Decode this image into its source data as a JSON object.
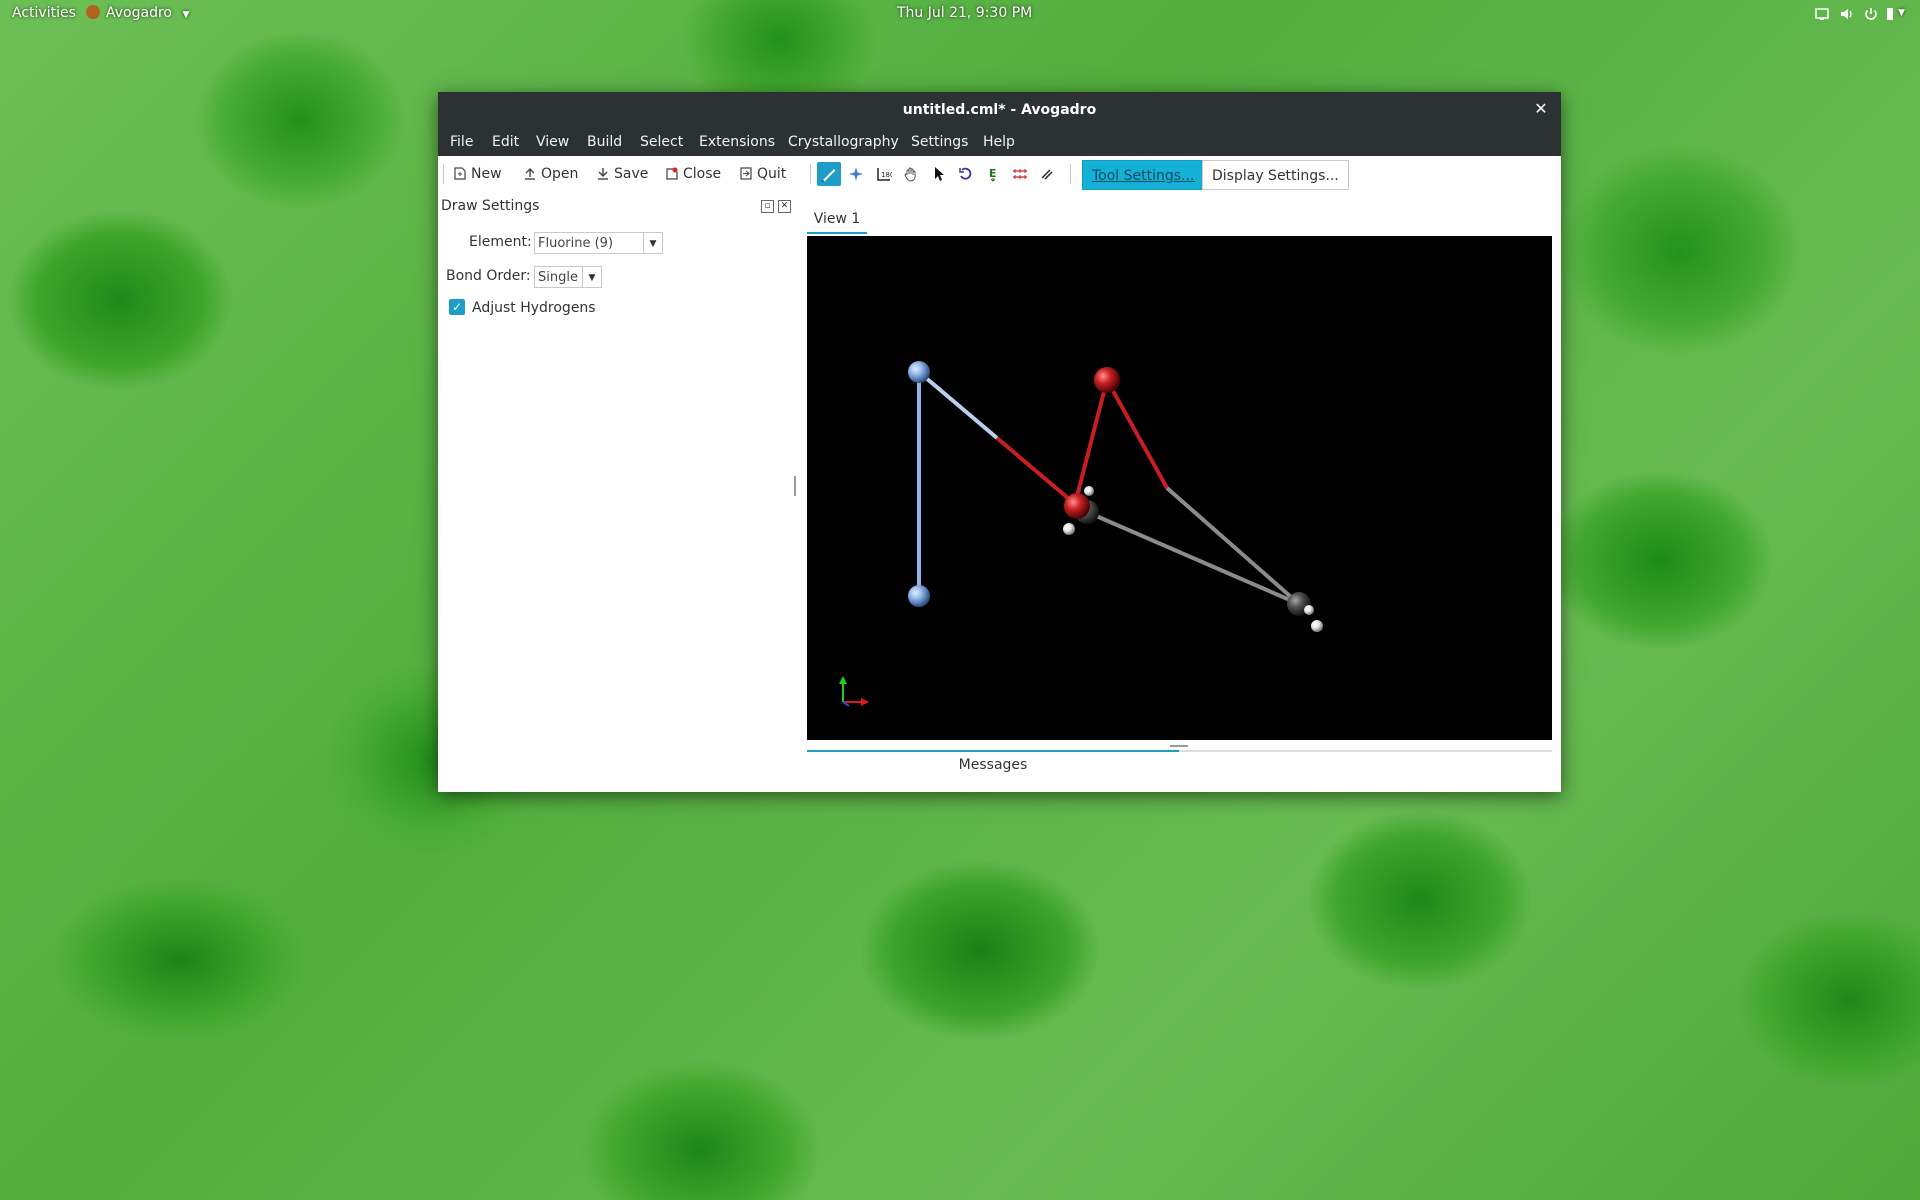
{
  "topbar": {
    "activities": "Activities",
    "app_name": "Avogadro",
    "clock": "Thu Jul 21,  9:30 PM"
  },
  "window": {
    "title": "untitled.cml* - Avogadro",
    "menu": [
      "File",
      "Edit",
      "View",
      "Build",
      "Select",
      "Extensions",
      "Crystallography",
      "Settings",
      "Help"
    ]
  },
  "toolbar": {
    "new_label": "New",
    "open_label": "Open",
    "save_label": "Save",
    "close_label": "Close",
    "quit_label": "Quit",
    "tool_settings_label": "Tool Settings...",
    "display_settings_label": "Display Settings...",
    "tools": [
      "draw-tool-icon",
      "navigate-tool-icon",
      "measure-tool-icon",
      "manipulate-tool-icon",
      "select-tool-icon",
      "rotate-tool-icon",
      "autoopt-tool-icon",
      "align-tool-icon",
      "bond-centric-tool-icon"
    ]
  },
  "dock": {
    "title": "Draw Settings",
    "element_label": "Element:",
    "element_value": "Fluorine (9)",
    "bond_order_label": "Bond Order:",
    "bond_order_value": "Single",
    "adjust_hydrogens_label": "Adjust Hydrogens",
    "adjust_hydrogens_checked": true
  },
  "view": {
    "tab_label": "View 1",
    "messages_label": "Messages"
  },
  "colors": {
    "accent": "#1e9ec7",
    "titlebar": "#2c3133",
    "fluorine": "#8fb4e8",
    "oxygen": "#c81e22",
    "carbon": "#505050",
    "hydrogen": "#e6e6e6"
  }
}
